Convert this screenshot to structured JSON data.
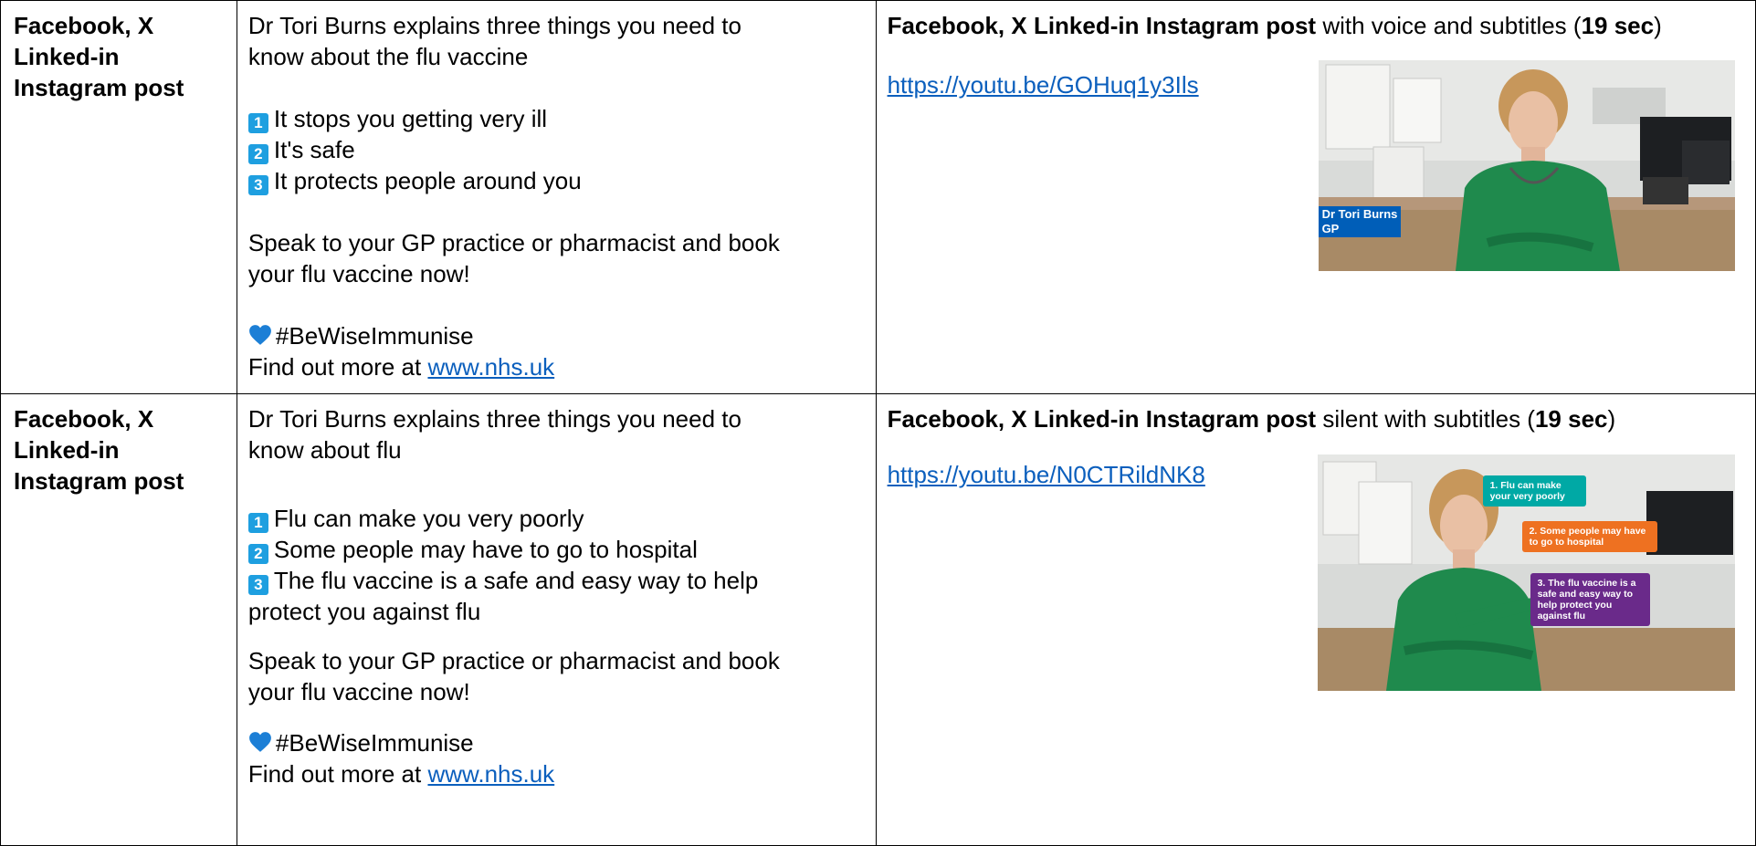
{
  "rows": [
    {
      "platform": "Facebook, X Linked-in Instagram post",
      "platform_lines": [
        "Facebook, X",
        "Linked-in",
        "Instagram post"
      ],
      "intro": [
        "Dr Tori Burns explains three things you need to",
        "know about the flu vaccine"
      ],
      "points": [
        {
          "num": "1",
          "text": "It stops you getting very ill"
        },
        {
          "num": "2",
          "text": "It's safe"
        },
        {
          "num": "3",
          "text": "It protects people around you"
        }
      ],
      "cta": [
        "Speak to your GP practice or pharmacist and book",
        "your flu vaccine now!"
      ],
      "hashtag": "#BeWiseImmunise",
      "find_more": "Find out more at ",
      "find_more_link": "www.nhs.uk",
      "video_title_bold": "Facebook, X Linked-in Instagram post",
      "video_title_rest": " with voice and subtitles (",
      "video_duration": "19 sec",
      "video_close": ")",
      "video_url": "https://youtu.be/GOHuq1y3Ils",
      "thumb_label": [
        "Dr Tori Burns",
        "GP"
      ]
    },
    {
      "platform": "Facebook, X Linked-in Instagram post",
      "platform_lines": [
        "Facebook, X",
        "Linked-in",
        "Instagram post"
      ],
      "intro": [
        "Dr Tori Burns explains three things you need to",
        "know about flu"
      ],
      "points": [
        {
          "num": "1",
          "text": "Flu can make you very poorly"
        },
        {
          "num": "2",
          "text": "Some people may have to go to hospital"
        },
        {
          "num": "3",
          "text": "The flu vaccine is a safe and easy way to help"
        }
      ],
      "point3_cont": "protect you against flu",
      "cta": [
        "Speak to your GP practice or pharmacist and book",
        "your flu vaccine now!"
      ],
      "hashtag": "#BeWiseImmunise",
      "find_more": "Find out more at ",
      "find_more_link": "www.nhs.uk",
      "video_title_bold": "Facebook, X Linked-in Instagram post",
      "video_title_rest": " silent with subtitles (",
      "video_duration": "19 sec",
      "video_close": ")",
      "video_url": "https://youtu.be/N0CTRildNK8",
      "thumb_bubbles": [
        "1. Flu can make your very poorly",
        "2. Some people may have to go to hospital",
        "3. The flu vaccine is a safe and easy way to help protect you against flu"
      ]
    }
  ],
  "colors": {
    "badge": "#1e9fe0",
    "link": "#0b5fbd",
    "heart": "#1c7fd6",
    "nhs_blue": "#005eb8",
    "bubble_teal": "#00a9a5",
    "bubble_orange": "#ee7121",
    "bubble_purple": "#6a2a8a"
  }
}
